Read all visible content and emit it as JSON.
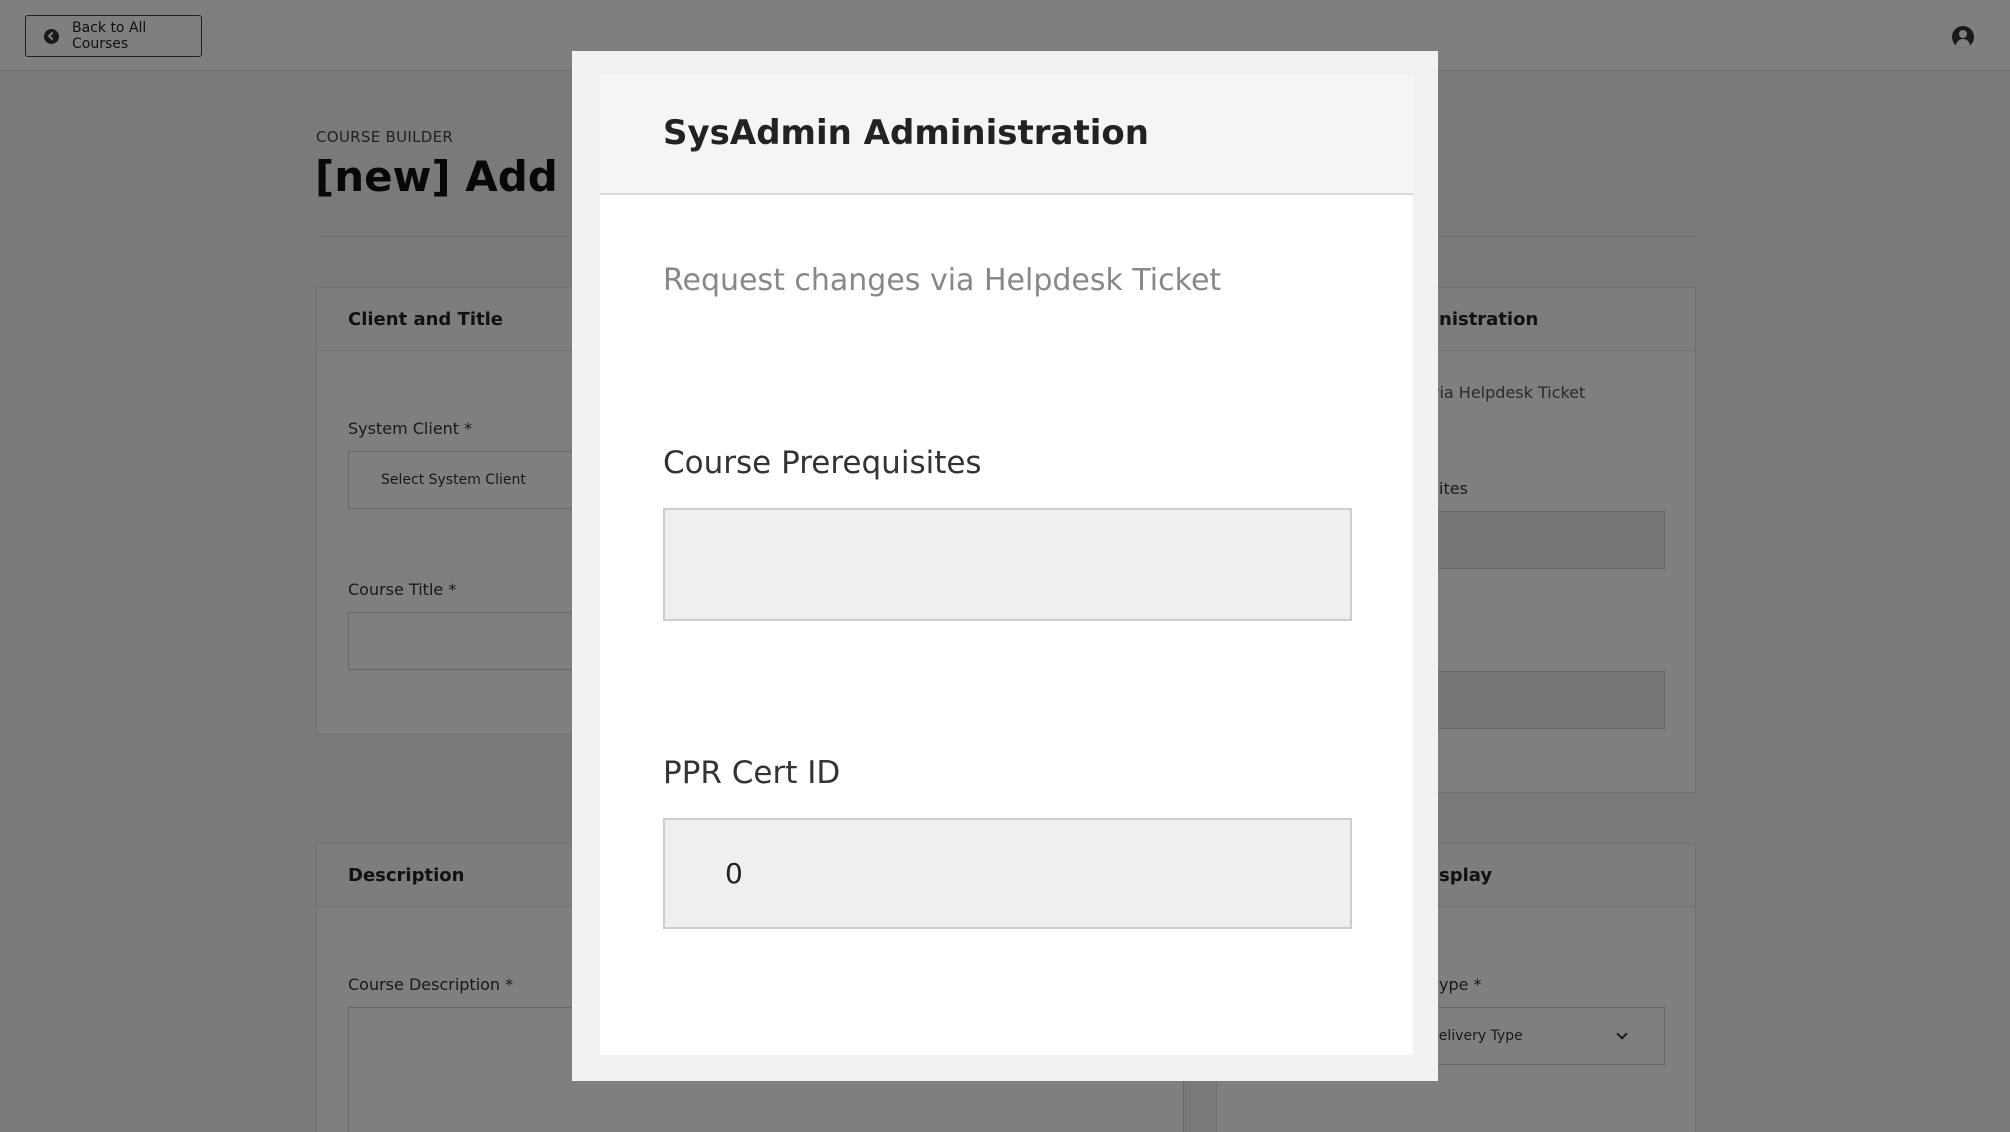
{
  "topbar": {
    "back_label": "Back to All Courses",
    "back_icon": "chevron-left-circle-icon",
    "user_icon": "user-circle-icon"
  },
  "page": {
    "eyebrow": "COURSE BUILDER",
    "title": "[new] Add Co"
  },
  "client_card": {
    "title": "Client and Title",
    "system_client_label": "System Client *",
    "system_client_placeholder": "Select System Client",
    "course_title_label": "Course Title *"
  },
  "description_card": {
    "title": "Description",
    "course_description_label": "Course Description *"
  },
  "right_admin_card": {
    "title_fragment": "nistration",
    "note_fragment": "via Helpdesk Ticket",
    "prereq_label_fragment": "ites"
  },
  "right_display_card": {
    "title_fragment": "splay",
    "delivery_label_fragment": "ype *",
    "delivery_value_fragment": "Delivery Type"
  },
  "modal": {
    "title": "SysAdmin Administration",
    "note": "Request changes via Helpdesk Ticket",
    "prereq_label": "Course Prerequisites",
    "prereq_value": "",
    "ppr_label": "PPR Cert ID",
    "ppr_value": "0"
  },
  "colors": {
    "overlay": "#000000",
    "modal_header_bg": "#f5f5f5",
    "disabled_field_bg": "#efefef"
  }
}
